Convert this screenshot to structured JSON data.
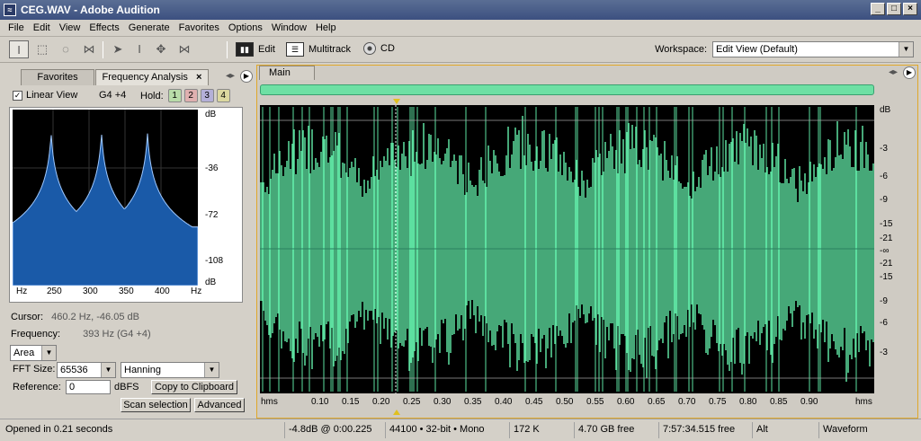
{
  "window": {
    "title": "CEG.WAV - Adobe Audition"
  },
  "menu": [
    "File",
    "Edit",
    "View",
    "Effects",
    "Generate",
    "Favorites",
    "Options",
    "Window",
    "Help"
  ],
  "toolbar": {
    "edit_label": "Edit",
    "multitrack_label": "Multitrack",
    "cd_label": "CD",
    "workspace_label": "Workspace:",
    "workspace_value": "Edit View (Default)"
  },
  "left_panel": {
    "tab_favorites": "Favorites",
    "tab_frequency": "Frequency Analysis",
    "linear_view_label": "Linear View",
    "linear_view_checked": true,
    "note": "G4 +4",
    "hold_label": "Hold:",
    "hold_buttons": [
      "1",
      "2",
      "3",
      "4"
    ],
    "graph_x_labels": [
      "Hz",
      "250",
      "300",
      "350",
      "400",
      "Hz"
    ],
    "graph_y_labels": [
      "dB",
      "-36",
      "-72",
      "-108",
      "dB"
    ],
    "spectrum": {
      "x_range_hz": [
        210,
        460
      ],
      "y_range_db": [
        -120,
        0
      ],
      "peaks_hz": [
        262,
        330,
        392
      ],
      "fill_color": "#1a5aa8",
      "line_color": "#9ec8ff"
    },
    "cursor_label": "Cursor:",
    "cursor_value": "460.2 Hz, -46.05 dB",
    "frequency_label": "Frequency:",
    "frequency_value": "393 Hz (G4 +4)",
    "display_mode": "Area",
    "fft_size_label": "FFT Size:",
    "fft_size_value": "65536",
    "window_func": "Hanning",
    "reference_label": "Reference:",
    "reference_value": "0",
    "reference_unit": "dBFS",
    "copy_button": "Copy to Clipboard",
    "scan_button": "Scan selection",
    "advanced_button": "Advanced"
  },
  "main": {
    "tab_label": "Main",
    "waveform_color": "#5de0a0",
    "db_labels": [
      "dB",
      "-3",
      "-6",
      "-9",
      "-15",
      "-21",
      "-∞",
      "-21",
      "-15",
      "-9",
      "-6",
      "-3"
    ],
    "time_labels": [
      "hms",
      "0.10",
      "0.15",
      "0.20",
      "0.25",
      "0.30",
      "0.35",
      "0.40",
      "0.45",
      "0.50",
      "0.55",
      "0.60",
      "0.65",
      "0.70",
      "0.75",
      "0.80",
      "0.85",
      "0.90",
      "hms"
    ]
  },
  "status": {
    "message": "Opened in 0.21 seconds",
    "level": "-4.8dB @  0:00.225",
    "format": "44100 • 32-bit • Mono",
    "size": "172 K",
    "free": "4.70 GB free",
    "time_free": "7:57:34.515 free",
    "key": "Alt",
    "view": "Waveform"
  }
}
